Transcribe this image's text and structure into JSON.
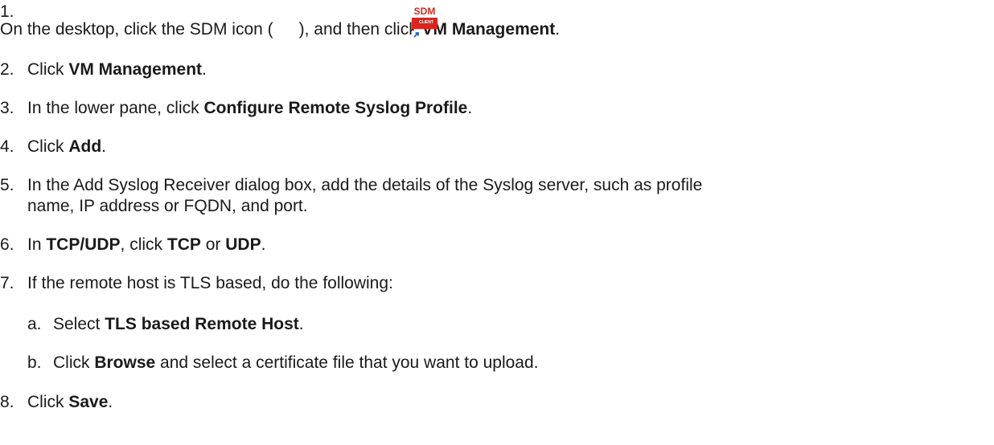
{
  "steps": [
    {
      "num": "1.",
      "pre": "On the desktop, click the SDM icon (",
      "post": "), and then click ",
      "bold": "VM Management",
      "end": "."
    },
    {
      "num": "2.",
      "pre": "Click ",
      "bold": "VM Management",
      "end": "."
    },
    {
      "num": "3.",
      "pre": "In the lower pane, click ",
      "bold": "Configure Remote Syslog Profile",
      "end": "."
    },
    {
      "num": "4.",
      "pre": "Click ",
      "bold": "Add",
      "end": "."
    },
    {
      "num": "5.",
      "line1": "In the Add Syslog Receiver dialog box, add the details of the Syslog server, such as profile",
      "line2": "name, IP address or FQDN, and port."
    },
    {
      "num": "6.",
      "pre": "In ",
      "bold1": "TCP/UDP",
      "mid1": ", click ",
      "bold2": "TCP",
      "mid2": " or ",
      "bold3": "UDP",
      "end": "."
    },
    {
      "num": "7.",
      "text": "If the remote host is TLS based, do the following:"
    },
    {
      "num": "a.",
      "pre": "Select ",
      "bold": "TLS based Remote Host",
      "end": "."
    },
    {
      "num": "b.",
      "pre": "Click ",
      "bold": "Browse",
      "post": " and select a certificate file that you want to upload."
    },
    {
      "num": "8.",
      "pre": "Click ",
      "bold": "Save",
      "end": "."
    }
  ],
  "sdm_icon": {
    "top_text": "SDM",
    "bottom_text": "CLIENT",
    "icon_name": "sdm-client-icon",
    "color": "#d9261c"
  }
}
